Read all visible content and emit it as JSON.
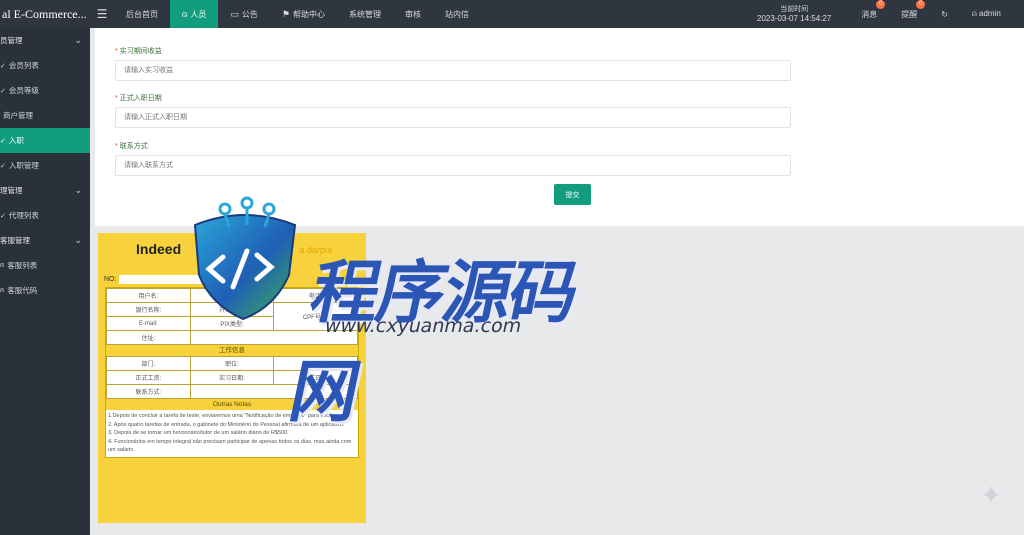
{
  "app": {
    "brand": "al E-Commerce..."
  },
  "topnav": {
    "items": [
      {
        "label": "后台首页",
        "icon": "home-icon"
      },
      {
        "label": "人员",
        "icon": "person-icon",
        "active": true
      },
      {
        "label": "公告",
        "icon": "notice-icon"
      },
      {
        "label": "帮助中心",
        "icon": "flag-icon"
      },
      {
        "label": "系统管理",
        "icon": "system-icon"
      },
      {
        "label": "审核",
        "icon": "audit-icon"
      },
      {
        "label": "站内信",
        "icon": "mail-icon"
      }
    ]
  },
  "topright": {
    "clock_label": "当前时间",
    "clock_time": "2023-03-07 14:54:27",
    "messages_label": "消息",
    "messages_badge": "0",
    "notices_label": "提醒",
    "notices_badge": "0",
    "refresh_icon": "↻",
    "user": "admin"
  },
  "sidebar": {
    "items": [
      {
        "label": "员管理",
        "group": true
      },
      {
        "label": "会员列表"
      },
      {
        "label": "会员等级"
      },
      {
        "label": "商户管理"
      },
      {
        "label": "入职",
        "active": true
      },
      {
        "label": "入职管理"
      },
      {
        "label": "理管理",
        "group": true
      },
      {
        "label": "代理列表"
      },
      {
        "label": "客服管理",
        "group": true
      },
      {
        "label": "客服列表"
      },
      {
        "label": "客服代码"
      }
    ]
  },
  "form": {
    "fields": [
      {
        "label": "实习期间收益",
        "placeholder": "请输入实习收益"
      },
      {
        "label": "正式入职日期",
        "placeholder": "请输入正式入职日期"
      },
      {
        "label": "联系方式",
        "placeholder": "请输入联系方式"
      }
    ],
    "submit_label": "提交"
  },
  "doc": {
    "title": "Indeed",
    "subtitle": "a darpui",
    "no_label": "NO:",
    "rows_personal": [
      [
        "用户名:",
        "",
        "电话:"
      ],
      [
        "银行名称:",
        "开户账户:",
        "CPF号码:"
      ],
      [
        "E-mail:",
        "PIX类型:",
        ""
      ],
      [
        "住址:",
        "",
        ""
      ]
    ],
    "work_head": "工作信息",
    "rows_work": [
      [
        "部门:",
        "职位:",
        "实习工资:"
      ],
      [
        "正式工资:",
        "实习日期:",
        "正式日期:"
      ],
      [
        "联系方式:",
        "",
        ""
      ]
    ],
    "notes_head": "Outras Notas",
    "notes": [
      "1.Depois de concluir a tarefa de teste, enviaremos uma \"Notificação de emprego\" para você.",
      "2. Após quatro tarefas de entrada, o gabinete do Ministério do Pessoal afirmara de um aplicativo.",
      "3. Depois de se tornar um funcionário/tutor de um salário diário de R$500.",
      "4. Funcionários em tempo integral não precisam participar de apenas todos os dias, mas ainda com um salário."
    ]
  },
  "watermark": {
    "text": "程序源码网",
    "url": "www.cxyuanma.com"
  }
}
